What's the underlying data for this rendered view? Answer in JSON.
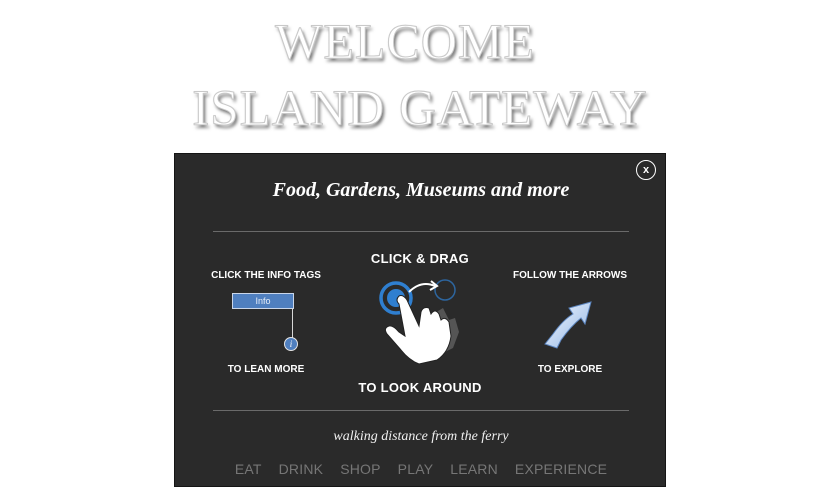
{
  "hero": {
    "line1": "WELCOME",
    "line2": "ISLAND GATEWAY"
  },
  "modal": {
    "close_label": "x",
    "title": "Food, Gardens, Museums and more",
    "tip_left": {
      "heading": "CLICK THE INFO TAGS",
      "tag_label": "Info",
      "dot_label": "i",
      "caption": "TO LEAN MORE"
    },
    "tip_center": {
      "heading": "CLICK & DRAG",
      "caption": "TO LOOK  AROUND"
    },
    "tip_right": {
      "heading": "FOLLOW THE ARROWS",
      "caption": "TO EXPLORE"
    },
    "subtitle": "walking distance from the ferry",
    "nav": [
      "EAT",
      "DRINK",
      "SHOP",
      "PLAY",
      "LEARN",
      "EXPERIENCE"
    ]
  },
  "colors": {
    "panel_bg": "#2a2a2a",
    "info_blue": "#4f7fbf",
    "drag_blue": "#2f7fd0",
    "nav_text": "#767676"
  },
  "icons": [
    "close-icon",
    "info-tag-icon",
    "hand-drag-icon",
    "direction-arrow-icon"
  ]
}
